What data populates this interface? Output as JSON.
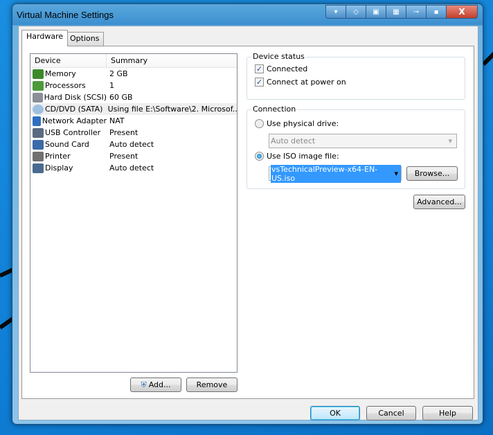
{
  "window": {
    "title": "Virtual Machine Settings",
    "controls": [
      "collapse-icon",
      "fit-icon",
      "enter-icon",
      "unity-icon",
      "connect-icon",
      "minimize-icon",
      "close-icon"
    ]
  },
  "tabs": [
    {
      "label": "Hardware",
      "active": true
    },
    {
      "label": "Options",
      "active": false
    }
  ],
  "device_list": {
    "headers": [
      "Device",
      "Summary"
    ],
    "rows": [
      {
        "device": "Memory",
        "summary": "2 GB",
        "icon": "memory-icon",
        "color": "#3a8a2a"
      },
      {
        "device": "Processors",
        "summary": "1",
        "icon": "processor-icon",
        "color": "#4a9a3a"
      },
      {
        "device": "Hard Disk (SCSI)",
        "summary": "60 GB",
        "icon": "hard-disk-icon",
        "color": "#8a8f98"
      },
      {
        "device": "CD/DVD (SATA)",
        "summary": "Using file E:\\Software\\2. Microsof...",
        "icon": "cd-dvd-icon",
        "color": "#9fbfe0",
        "selected": true
      },
      {
        "device": "Network Adapter",
        "summary": "NAT",
        "icon": "network-adapter-icon",
        "color": "#2f6fc0"
      },
      {
        "device": "USB Controller",
        "summary": "Present",
        "icon": "usb-icon",
        "color": "#5a6a80"
      },
      {
        "device": "Sound Card",
        "summary": "Auto detect",
        "icon": "sound-card-icon",
        "color": "#3a6aa8"
      },
      {
        "device": "Printer",
        "summary": "Present",
        "icon": "printer-icon",
        "color": "#707070"
      },
      {
        "device": "Display",
        "summary": "Auto detect",
        "icon": "display-icon",
        "color": "#4a6a90"
      }
    ]
  },
  "buttons": {
    "add": "Add...",
    "remove": "Remove",
    "browse": "Browse...",
    "advanced": "Advanced...",
    "ok": "OK",
    "cancel": "Cancel",
    "help": "Help"
  },
  "device_status": {
    "label": "Device status",
    "connected": {
      "label": "Connected",
      "checked": true
    },
    "connect_power_on": {
      "label": "Connect at power on",
      "checked": true
    }
  },
  "connection": {
    "label": "Connection",
    "physical": {
      "label": "Use physical drive:",
      "selected": false,
      "value": "Auto detect"
    },
    "iso": {
      "label": "Use ISO image file:",
      "selected": true,
      "value": "vsTechnicalPreview-x64-EN-US.iso"
    }
  }
}
